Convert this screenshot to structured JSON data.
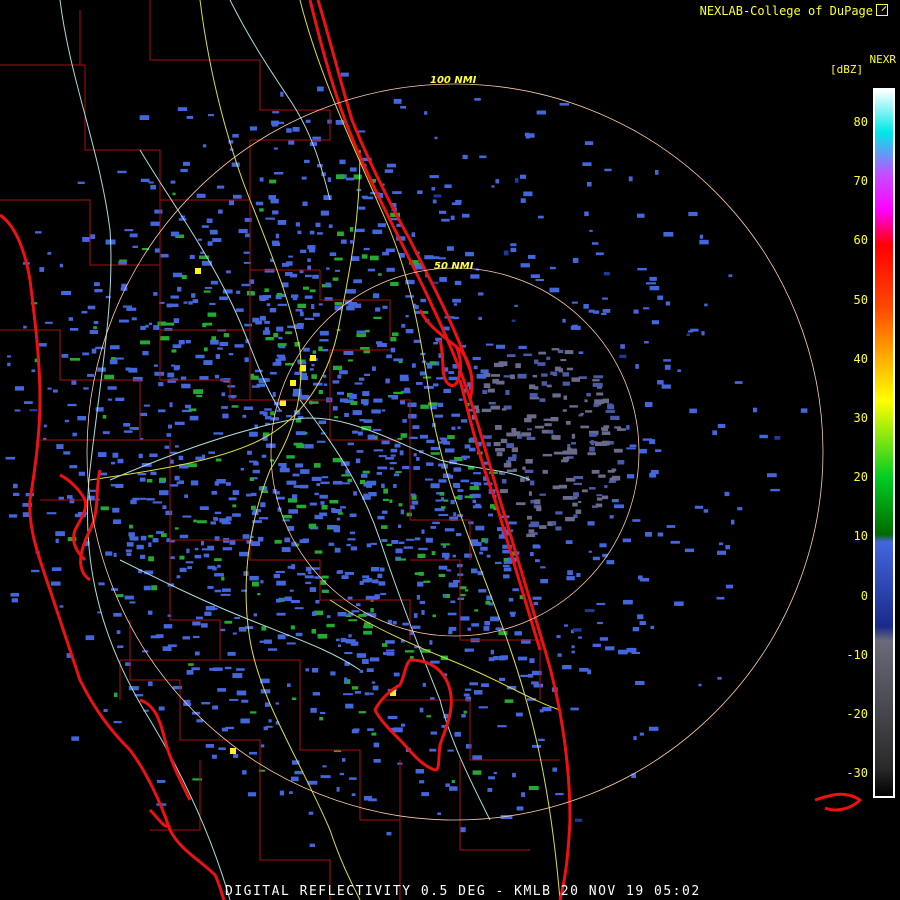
{
  "header": {
    "credit": "NEXLAB-College of DuPage",
    "product": "NEXR",
    "unit": "[dBZ]"
  },
  "range_rings": [
    {
      "label": "100 NMI"
    },
    {
      "label": "50 NMI"
    }
  ],
  "color_scale": {
    "labels": [
      "80",
      "70",
      "60",
      "50",
      "40",
      "30",
      "20",
      "10",
      "0",
      "-10",
      "-20",
      "-30"
    ],
    "colors": [
      "#00e8e8",
      "#c44dff",
      "#ff00ff",
      "#ff0000",
      "#ff4a00",
      "#ffa000",
      "#ffff00",
      "#00cc22",
      "#006a00",
      "#4466dd",
      "#1a2a8a",
      "#6a6a7a",
      "#2a2a2a"
    ]
  },
  "footer": {
    "title": "DIGITAL REFLECTIVITY 0.5 DEG - KMLB 20 NOV 19 05:02"
  },
  "layers": {
    "coastline_color": "#ee1111",
    "county_color": "#aa1111",
    "highway_color": "#dddd44",
    "road_color": "#aadddd",
    "ring_color": "#ffccaa"
  }
}
